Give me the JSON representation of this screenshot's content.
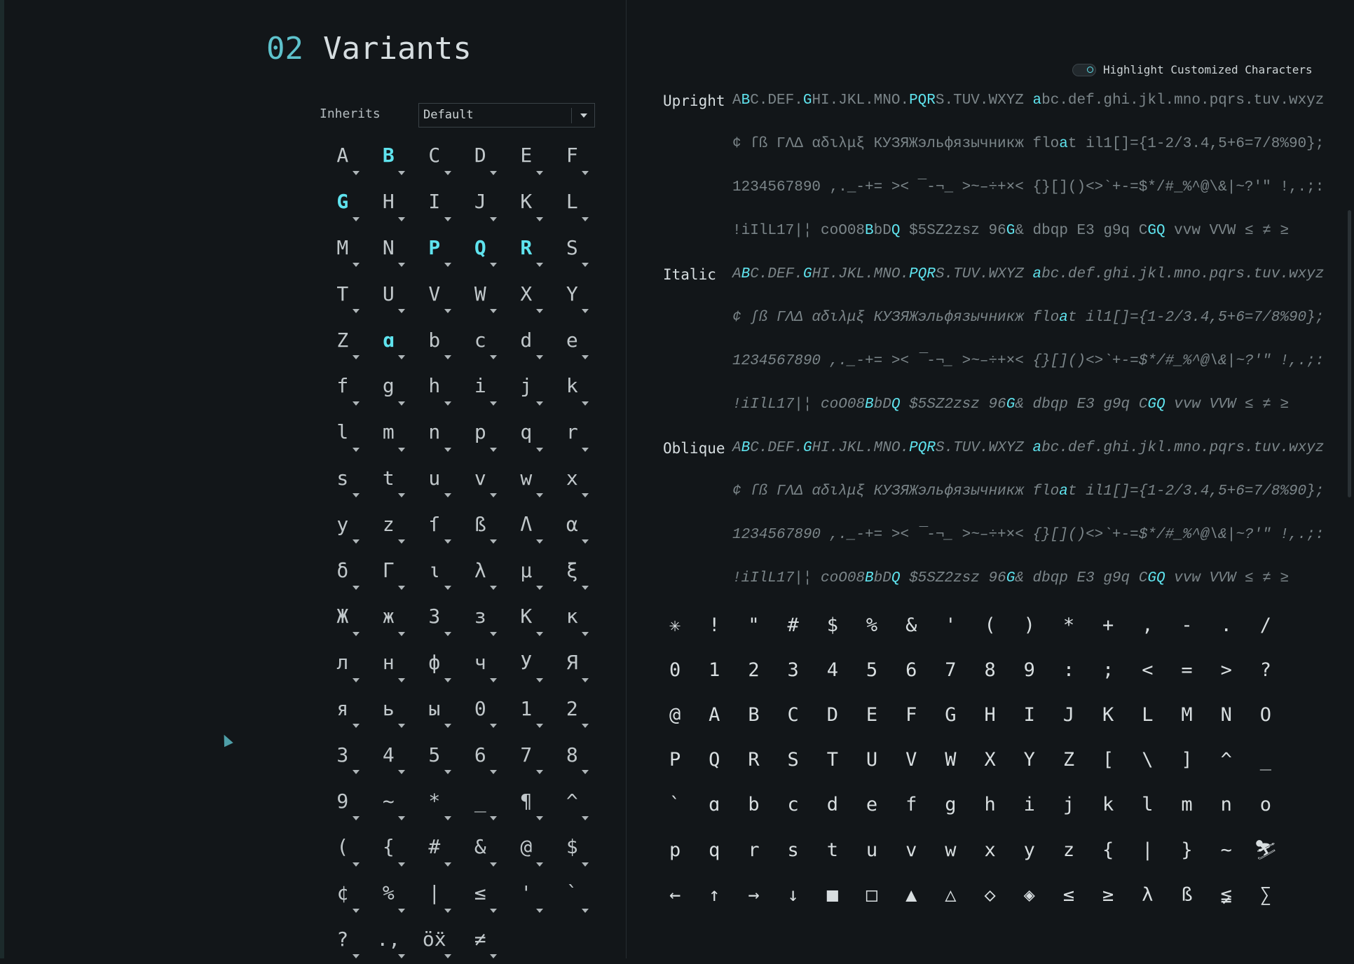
{
  "header": {
    "number": "02",
    "title": "Variants"
  },
  "inherits": {
    "label": "Inherits",
    "value": "Default"
  },
  "highlight_toggle": {
    "label": "Highlight Customized Characters",
    "on": true
  },
  "variant_grid": [
    {
      "ch": "A",
      "hl": false
    },
    {
      "ch": "B",
      "hl": true
    },
    {
      "ch": "C",
      "hl": false
    },
    {
      "ch": "D",
      "hl": false
    },
    {
      "ch": "E",
      "hl": false
    },
    {
      "ch": "F",
      "hl": false
    },
    {
      "ch": "G",
      "hl": true
    },
    {
      "ch": "H",
      "hl": false
    },
    {
      "ch": "I",
      "hl": false
    },
    {
      "ch": "J",
      "hl": false
    },
    {
      "ch": "K",
      "hl": false
    },
    {
      "ch": "L",
      "hl": false
    },
    {
      "ch": "M",
      "hl": false
    },
    {
      "ch": "N",
      "hl": false
    },
    {
      "ch": "P",
      "hl": true
    },
    {
      "ch": "Q",
      "hl": true
    },
    {
      "ch": "R",
      "hl": true
    },
    {
      "ch": "S",
      "hl": false
    },
    {
      "ch": "T",
      "hl": false
    },
    {
      "ch": "U",
      "hl": false
    },
    {
      "ch": "V",
      "hl": false
    },
    {
      "ch": "W",
      "hl": false
    },
    {
      "ch": "X",
      "hl": false
    },
    {
      "ch": "Y",
      "hl": false
    },
    {
      "ch": "Z",
      "hl": false
    },
    {
      "ch": "ɑ",
      "hl": true
    },
    {
      "ch": "b",
      "hl": false
    },
    {
      "ch": "c",
      "hl": false
    },
    {
      "ch": "d",
      "hl": false
    },
    {
      "ch": "e",
      "hl": false
    },
    {
      "ch": "f",
      "hl": false
    },
    {
      "ch": "g",
      "hl": false
    },
    {
      "ch": "h",
      "hl": false
    },
    {
      "ch": "i",
      "hl": false
    },
    {
      "ch": "j",
      "hl": false
    },
    {
      "ch": "k",
      "hl": false
    },
    {
      "ch": "l",
      "hl": false
    },
    {
      "ch": "m",
      "hl": false
    },
    {
      "ch": "n",
      "hl": false
    },
    {
      "ch": "p",
      "hl": false
    },
    {
      "ch": "q",
      "hl": false
    },
    {
      "ch": "r",
      "hl": false
    },
    {
      "ch": "s",
      "hl": false
    },
    {
      "ch": "t",
      "hl": false
    },
    {
      "ch": "u",
      "hl": false
    },
    {
      "ch": "v",
      "hl": false
    },
    {
      "ch": "w",
      "hl": false
    },
    {
      "ch": "x",
      "hl": false
    },
    {
      "ch": "y",
      "hl": false
    },
    {
      "ch": "z",
      "hl": false
    },
    {
      "ch": "ſ",
      "hl": false
    },
    {
      "ch": "ß",
      "hl": false
    },
    {
      "ch": "Λ",
      "hl": false
    },
    {
      "ch": "α",
      "hl": false
    },
    {
      "ch": "δ",
      "hl": false
    },
    {
      "ch": "Γ",
      "hl": false
    },
    {
      "ch": "ι",
      "hl": false
    },
    {
      "ch": "λ",
      "hl": false
    },
    {
      "ch": "μ",
      "hl": false
    },
    {
      "ch": "ξ",
      "hl": false
    },
    {
      "ch": "Ж",
      "hl": false
    },
    {
      "ch": "ж",
      "hl": false
    },
    {
      "ch": "З",
      "hl": false
    },
    {
      "ch": "з",
      "hl": false
    },
    {
      "ch": "К",
      "hl": false
    },
    {
      "ch": "к",
      "hl": false
    },
    {
      "ch": "л",
      "hl": false
    },
    {
      "ch": "н",
      "hl": false
    },
    {
      "ch": "ф",
      "hl": false
    },
    {
      "ch": "ч",
      "hl": false
    },
    {
      "ch": "У",
      "hl": false
    },
    {
      "ch": "Я",
      "hl": false
    },
    {
      "ch": "я",
      "hl": false
    },
    {
      "ch": "ь",
      "hl": false
    },
    {
      "ch": "ы",
      "hl": false
    },
    {
      "ch": "0",
      "hl": false
    },
    {
      "ch": "1",
      "hl": false
    },
    {
      "ch": "2",
      "hl": false
    },
    {
      "ch": "3",
      "hl": false
    },
    {
      "ch": "4",
      "hl": false
    },
    {
      "ch": "5",
      "hl": false
    },
    {
      "ch": "6",
      "hl": false
    },
    {
      "ch": "7",
      "hl": false
    },
    {
      "ch": "8",
      "hl": false
    },
    {
      "ch": "9",
      "hl": false
    },
    {
      "ch": "~",
      "hl": false
    },
    {
      "ch": "*",
      "hl": false
    },
    {
      "ch": "_",
      "hl": false
    },
    {
      "ch": "¶",
      "hl": false
    },
    {
      "ch": "^",
      "hl": false
    },
    {
      "ch": "(",
      "hl": false
    },
    {
      "ch": "{",
      "hl": false
    },
    {
      "ch": "#",
      "hl": false
    },
    {
      "ch": "&",
      "hl": false
    },
    {
      "ch": "@",
      "hl": false
    },
    {
      "ch": "$",
      "hl": false
    },
    {
      "ch": "¢",
      "hl": false
    },
    {
      "ch": "%",
      "hl": false
    },
    {
      "ch": "|",
      "hl": false
    },
    {
      "ch": "≤",
      "hl": false
    },
    {
      "ch": "'",
      "hl": false
    },
    {
      "ch": "`",
      "hl": false
    },
    {
      "ch": "?",
      "hl": false
    },
    {
      "ch": ".,",
      "hl": false
    },
    {
      "ch": "öẍ",
      "hl": false
    },
    {
      "ch": "≠",
      "hl": false
    }
  ],
  "samples": [
    {
      "label": "Upright",
      "italic": false,
      "lines": [
        [
          [
            "A",
            0
          ],
          [
            "B",
            1
          ],
          [
            "C.DEF.",
            0
          ],
          [
            "G",
            1
          ],
          [
            "HI.JKL.MNO.",
            0
          ],
          [
            "PQR",
            1
          ],
          [
            "S.TUV.WXYZ ",
            0
          ],
          [
            "a",
            1
          ],
          [
            "bc.def.ghi.jkl.mno.pqrs.tuv.wxyz",
            0
          ]
        ],
        [
          [
            "¢ ſß ΓΛΔ αδιλμξ КУЗЯЖэльфязычникж flo",
            0
          ],
          [
            "a",
            1
          ],
          [
            "t il1[]={1-2/3.4,5+6=7/8%90};",
            0
          ]
        ],
        [
          [
            "1234567890 ,._-+= >< ¯-¬_ >~–÷+×< {}[]()<>`+-=$*/#_%^@\\&|~?'\" !,.;:",
            0
          ]
        ],
        [
          [
            "!iIlL17|¦ coO08",
            0
          ],
          [
            "B",
            1
          ],
          [
            "bD",
            0
          ],
          [
            "Q",
            1
          ],
          [
            " $5SZ2zsz 96",
            0
          ],
          [
            "G",
            1
          ],
          [
            "& dbqp E3 g9q C",
            0
          ],
          [
            "GQ",
            1
          ],
          [
            " vvw VVW ≤ ≠ ≥",
            0
          ]
        ]
      ]
    },
    {
      "label": "Italic",
      "italic": true,
      "lines": [
        [
          [
            "A",
            0
          ],
          [
            "B",
            1
          ],
          [
            "C.DEF.",
            0
          ],
          [
            "G",
            1
          ],
          [
            "HI.JKL.MNO.",
            0
          ],
          [
            "PQR",
            1
          ],
          [
            "S.TUV.WXYZ ",
            0
          ],
          [
            "a",
            1
          ],
          [
            "bc.def.ghi.jkl.mno.pqrs.tuv.wxyz",
            0
          ]
        ],
        [
          [
            "¢ ʃß ΓΛΔ αδιλμξ КУЗЯЖэльфязычникж flo",
            0
          ],
          [
            "a",
            1
          ],
          [
            "t il1[]={1-2/3.4,5+6=7/8%90};",
            0
          ]
        ],
        [
          [
            "1234567890 ,._-+= >< ¯-¬_ >~–÷+×< {}[]()<>`+-=$*/#_%^@\\&|~?'\" !,.;:",
            0
          ]
        ],
        [
          [
            "!iIlL17|¦ coO08",
            0
          ],
          [
            "B",
            1
          ],
          [
            "bD",
            0
          ],
          [
            "Q",
            1
          ],
          [
            " $5SZ2zsz 96",
            0
          ],
          [
            "G",
            1
          ],
          [
            "& dbqp E3 g9q C",
            0
          ],
          [
            "GQ",
            1
          ],
          [
            " vvw VVW ≤ ≠ ≥",
            0
          ]
        ]
      ]
    },
    {
      "label": "Oblique",
      "italic": true,
      "lines": [
        [
          [
            "A",
            0
          ],
          [
            "B",
            1
          ],
          [
            "C.DEF.",
            0
          ],
          [
            "G",
            1
          ],
          [
            "HI.JKL.MNO.",
            0
          ],
          [
            "PQR",
            1
          ],
          [
            "S.TUV.WXYZ ",
            0
          ],
          [
            "a",
            1
          ],
          [
            "bc.def.ghi.jkl.mno.pqrs.tuv.wxyz",
            0
          ]
        ],
        [
          [
            "¢ ſß ΓΛΔ αδιλμξ КУЗЯЖэльфязычникж flo",
            0
          ],
          [
            "a",
            1
          ],
          [
            "t il1[]={1-2/3.4,5+6=7/8%90};",
            0
          ]
        ],
        [
          [
            "1234567890 ,._-+= >< ¯-¬_ >~–÷+×< {}[]()<>`+-=$*/#_%^@\\&|~?'\" !,.;:",
            0
          ]
        ],
        [
          [
            "!iIlL17|¦ coO08",
            0
          ],
          [
            "B",
            1
          ],
          [
            "bD",
            0
          ],
          [
            "Q",
            1
          ],
          [
            " $5SZ2zsz 96",
            0
          ],
          [
            "G",
            1
          ],
          [
            "& dbqp E3 g9q C",
            0
          ],
          [
            "GQ",
            1
          ],
          [
            " vvw VVW ≤ ≠ ≥",
            0
          ]
        ]
      ]
    }
  ],
  "charmap": [
    "✳",
    "!",
    "\"",
    "#",
    "$",
    "%",
    "&",
    "'",
    "(",
    ")",
    "*",
    "+",
    ",",
    "-",
    ".",
    "/",
    "0",
    "1",
    "2",
    "3",
    "4",
    "5",
    "6",
    "7",
    "8",
    "9",
    ":",
    ";",
    "<",
    "=",
    ">",
    "?",
    "@",
    "A",
    "B",
    "C",
    "D",
    "E",
    "F",
    "G",
    "H",
    "I",
    "J",
    "K",
    "L",
    "M",
    "N",
    "O",
    "P",
    "Q",
    "R",
    "S",
    "T",
    "U",
    "V",
    "W",
    "X",
    "Y",
    "Z",
    "[",
    "\\",
    "]",
    "^",
    "_",
    "`",
    "ɑ",
    "b",
    "c",
    "d",
    "e",
    "f",
    "g",
    "h",
    "i",
    "j",
    "k",
    "l",
    "m",
    "n",
    "o",
    "p",
    "q",
    "r",
    "s",
    "t",
    "u",
    "v",
    "w",
    "x",
    "y",
    "z",
    "{",
    "|",
    "}",
    "~",
    "⛷",
    "←",
    "↑",
    "→",
    "↓",
    "■",
    "□",
    "▲",
    "△",
    "◇",
    "◈",
    "≤",
    "≥",
    "λ",
    "ß",
    "≨",
    "∑"
  ],
  "colors": {
    "background": "#121619",
    "accent": "#5fe3ee",
    "text": "#c0c7ca",
    "muted": "#7b8589"
  }
}
